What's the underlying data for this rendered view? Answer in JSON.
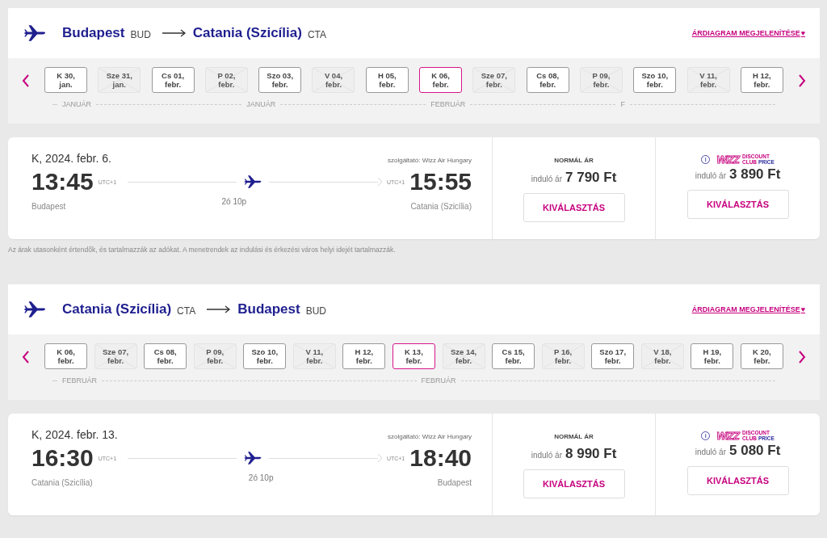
{
  "legs": [
    {
      "origin": {
        "city": "Budapest",
        "code": "BUD"
      },
      "destination": {
        "city": "Catania (Szicília)",
        "code": "CTA"
      },
      "chart_link": "ÁRDIAGRAM MEGJELENÍTÉSE",
      "heart": "♥",
      "dates": [
        {
          "day": "K 30,",
          "month": "jan.",
          "available": true,
          "selected": false
        },
        {
          "day": "Sze 31,",
          "month": "jan.",
          "available": false,
          "selected": false
        },
        {
          "day": "Cs 01,",
          "month": "febr.",
          "available": true,
          "selected": false
        },
        {
          "day": "P 02,",
          "month": "febr.",
          "available": false,
          "selected": false
        },
        {
          "day": "Szo 03,",
          "month": "febr.",
          "available": true,
          "selected": false
        },
        {
          "day": "V 04,",
          "month": "febr.",
          "available": false,
          "selected": false
        },
        {
          "day": "H 05,",
          "month": "febr.",
          "available": true,
          "selected": false
        },
        {
          "day": "K 06,",
          "month": "febr.",
          "available": true,
          "selected": true
        },
        {
          "day": "Sze 07,",
          "month": "febr.",
          "available": false,
          "selected": false
        },
        {
          "day": "Cs 08,",
          "month": "febr.",
          "available": true,
          "selected": false
        },
        {
          "day": "P 09,",
          "month": "febr.",
          "available": false,
          "selected": false
        },
        {
          "day": "Szo 10,",
          "month": "febr.",
          "available": true,
          "selected": false
        },
        {
          "day": "V 11,",
          "month": "febr.",
          "available": false,
          "selected": false
        },
        {
          "day": "H 12,",
          "month": "febr.",
          "available": true,
          "selected": false
        }
      ],
      "months": [
        "JANUÁR",
        "JANUÁR",
        "FEBRUÁR",
        "F"
      ],
      "flight": {
        "date": "K, 2024. febr. 6.",
        "operator": "szolgáltató: Wizz Air Hungary",
        "departure": "13:45",
        "departure_tz": "UTC+1",
        "arrival": "15:55",
        "arrival_tz": "UTC+1",
        "duration": "2ó 10p",
        "from": "Budapest",
        "to": "Catania (Szicília)",
        "fares": [
          {
            "kind": "normal",
            "title": "NORMÁL ÁR",
            "prefix": "induló ár",
            "price": "7 790 Ft",
            "button": "KIVÁLASZTÁS"
          },
          {
            "kind": "club",
            "info": "i",
            "brand": "WIZZ",
            "line1": "DISCOUNT",
            "line2a": "CLUB",
            "line2b": "PRICE",
            "prefix": "induló ár",
            "price": "3 890 Ft",
            "button": "KIVÁLASZTÁS"
          }
        ]
      },
      "note": "Az árak utasonként értendők, és tartalmazzák az adókat. A menetrendek az indulási és érkezési város helyi idejét tartalmazzák."
    },
    {
      "origin": {
        "city": "Catania (Szicília)",
        "code": "CTA"
      },
      "destination": {
        "city": "Budapest",
        "code": "BUD"
      },
      "chart_link": "ÁRDIAGRAM MEGJELENÍTÉSE",
      "heart": "♥",
      "dates": [
        {
          "day": "K 06,",
          "month": "febr.",
          "available": true,
          "selected": false
        },
        {
          "day": "Sze 07,",
          "month": "febr.",
          "available": false,
          "selected": false
        },
        {
          "day": "Cs 08,",
          "month": "febr.",
          "available": true,
          "selected": false
        },
        {
          "day": "P 09,",
          "month": "febr.",
          "available": false,
          "selected": false
        },
        {
          "day": "Szo 10,",
          "month": "febr.",
          "available": true,
          "selected": false
        },
        {
          "day": "V 11,",
          "month": "febr.",
          "available": false,
          "selected": false
        },
        {
          "day": "H 12,",
          "month": "febr.",
          "available": true,
          "selected": false
        },
        {
          "day": "K 13,",
          "month": "febr.",
          "available": true,
          "selected": true
        },
        {
          "day": "Sze 14,",
          "month": "febr.",
          "available": false,
          "selected": false
        },
        {
          "day": "Cs 15,",
          "month": "febr.",
          "available": true,
          "selected": false
        },
        {
          "day": "P 16,",
          "month": "febr.",
          "available": false,
          "selected": false
        },
        {
          "day": "Szo 17,",
          "month": "febr.",
          "available": true,
          "selected": false
        },
        {
          "day": "V 18,",
          "month": "febr.",
          "available": false,
          "selected": false
        },
        {
          "day": "H 19,",
          "month": "febr.",
          "available": true,
          "selected": false
        },
        {
          "day": "K 20,",
          "month": "febr.",
          "available": true,
          "selected": false
        }
      ],
      "months": [
        "FEBRUÁR",
        "FEBRUÁR"
      ],
      "flight": {
        "date": "K, 2024. febr. 13.",
        "operator": "szolgáltató: Wizz Air Hungary",
        "departure": "16:30",
        "departure_tz": "UTC+1",
        "arrival": "18:40",
        "arrival_tz": "UTC+1",
        "duration": "2ó 10p",
        "from": "Catania (Szicília)",
        "to": "Budapest",
        "fares": [
          {
            "kind": "normal",
            "title": "NORMÁL ÁR",
            "prefix": "induló ár",
            "price": "8 990 Ft",
            "button": "KIVÁLASZTÁS"
          },
          {
            "kind": "club",
            "info": "i",
            "brand": "WIZZ",
            "line1": "DISCOUNT",
            "line2a": "CLUB",
            "line2b": "PRICE",
            "prefix": "induló ár",
            "price": "5 080 Ft",
            "button": "KIVÁLASZTÁS"
          }
        ]
      }
    }
  ]
}
